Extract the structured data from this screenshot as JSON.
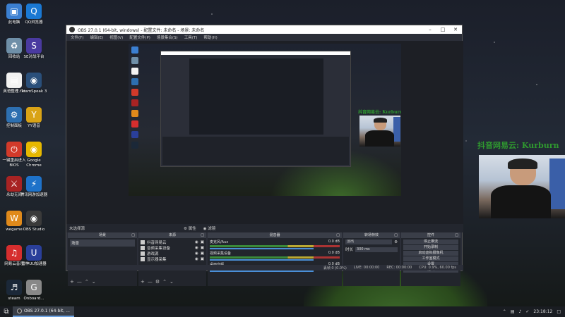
{
  "desktop_icons": [
    {
      "label": "此电脑",
      "color": "#3b7fd1"
    },
    {
      "label": "QQ浏览器",
      "color": "#1a78d3"
    },
    {
      "label": "回收站",
      "color": "#6f8fa8"
    },
    {
      "label": "SE对战平台",
      "color": "#4a3aa0"
    },
    {
      "label": "英语整理.txt",
      "color": "#f2f2f2"
    },
    {
      "label": "TeamSpeak 3",
      "color": "#2a4f7a"
    },
    {
      "label": "控制面板",
      "color": "#2d6fb0"
    },
    {
      "label": "YY语音",
      "color": "#d9a316"
    },
    {
      "label": "一键重启进入BIOS",
      "color": "#d23a2a"
    },
    {
      "label": "Google Chrome",
      "color": "#e6b800"
    },
    {
      "label": "永劫无间",
      "color": "#a82323"
    },
    {
      "label": "腾讯网游加速器",
      "color": "#1e72c9"
    },
    {
      "label": "wegame",
      "color": "#e08a1b"
    },
    {
      "label": "OBS Studio",
      "color": "#3a3a3a"
    },
    {
      "label": "网易云音乐",
      "color": "#d62e2e"
    },
    {
      "label": "雷神UU加速器",
      "color": "#2a3f9a"
    },
    {
      "label": "steam",
      "color": "#1b2838"
    },
    {
      "label": "Onboard...",
      "color": "#888888"
    }
  ],
  "obs": {
    "title": "OBS 27.0.1 (64-bit, windows) - 配置文件: 未命名 - 场景: 未命名",
    "menu": [
      "文件(F)",
      "编辑(E)",
      "视图(V)",
      "配置文件(P)",
      "场景集合(S)",
      "工具(T)",
      "帮助(H)"
    ],
    "status_line": {
      "text": "未选择源",
      "props_btn": "属性",
      "filter_btn": "滤镜"
    },
    "docks": {
      "scenes": {
        "title": "场景",
        "items": [
          "场景"
        ]
      },
      "sources": {
        "title": "来源",
        "items": [
          {
            "name": "抖音网易云",
            "icon": "text-icon"
          },
          {
            "name": "音频采集设备",
            "icon": "mic-icon"
          },
          {
            "name": "游戏源",
            "icon": "game-icon"
          },
          {
            "name": "显示器采集",
            "icon": "monitor-icon"
          }
        ]
      },
      "mixer": {
        "title": "混音器",
        "channels": [
          {
            "name": "麦克风/Aux",
            "db": "0.0 dB"
          },
          {
            "name": "视频采集设备",
            "db": "0.0 dB"
          },
          {
            "name": "桌面音频",
            "db": "0.0 dB"
          }
        ]
      },
      "transitions": {
        "title": "转场特效",
        "type": "淡出",
        "duration_label": "时长",
        "duration": "300 ms"
      },
      "controls": {
        "title": "控件",
        "buttons": [
          "停止推流",
          "开始录制",
          "启动虚拟摄像机",
          "工作室模式",
          "设置",
          "退出"
        ]
      }
    },
    "statusbar": [
      "丢帧 0 (0.0%)",
      "LIVE: 00:00:00",
      "REC: 00:00:00",
      "CPU: 0.9%, 60.00 fps"
    ]
  },
  "overlay": {
    "label_small": "抖音网易云: Kurburn",
    "label_large": "抖音网易云: Kurburn"
  },
  "taskbar": {
    "item": "OBS 27.0.1 (64-bit, ...",
    "time": "23:18:12"
  }
}
